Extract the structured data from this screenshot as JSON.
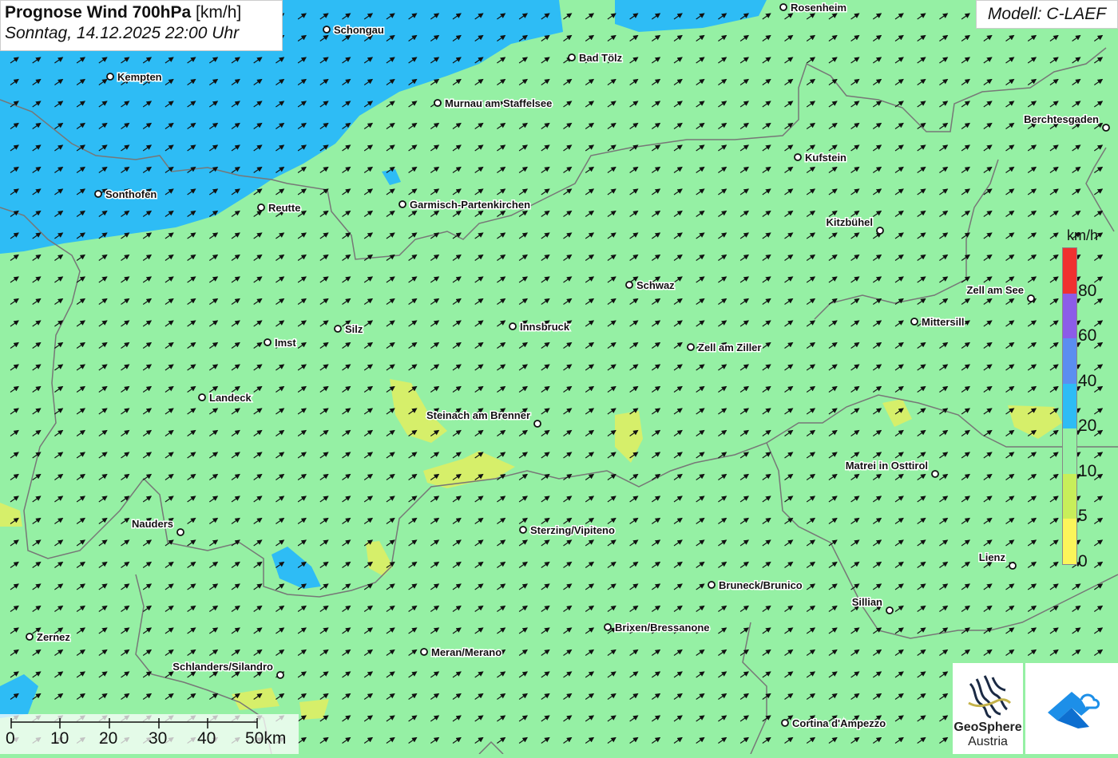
{
  "title": {
    "main": "Prognose Wind 700hPa",
    "unit": "[km/h]",
    "datetime": "Sonntag, 14.12.2025 22:00 Uhr"
  },
  "model": "Modell: C-LAEF",
  "legend": {
    "unit": "km/h",
    "labels": [
      "80",
      "60",
      "40",
      "20",
      "10",
      "5",
      "0"
    ],
    "colors": [
      "#f03030",
      "#8c5ce8",
      "#5b8ef0",
      "#2ebcf5",
      "#95f0a4",
      "#c8ee5a",
      "#fbf55a"
    ]
  },
  "scalebar": {
    "labels": [
      "0",
      "10",
      "20",
      "30",
      "40",
      "50km"
    ]
  },
  "logos": {
    "geosphere_line1": "GeoSphere",
    "geosphere_line2": "Austria"
  },
  "colors": {
    "calm_green": "#95f0a4",
    "blue_20": "#2ebcf5",
    "yellow_5": "#d6ef6a"
  },
  "cities": [
    {
      "name": "Rosenheim"
    },
    {
      "name": "Schongau"
    },
    {
      "name": "Bad Tölz"
    },
    {
      "name": "Kempten"
    },
    {
      "name": "Murnau am Staffelsee"
    },
    {
      "name": "Berchtesgaden"
    },
    {
      "name": "Kufstein"
    },
    {
      "name": "Sonthofen"
    },
    {
      "name": "Reutte"
    },
    {
      "name": "Garmisch-Partenkirchen"
    },
    {
      "name": "Kitzbühel"
    },
    {
      "name": "Schwaz"
    },
    {
      "name": "Zell am See"
    },
    {
      "name": "Innsbruck"
    },
    {
      "name": "Silz"
    },
    {
      "name": "Mittersill"
    },
    {
      "name": "Imst"
    },
    {
      "name": "Zell am Ziller"
    },
    {
      "name": "Landeck"
    },
    {
      "name": "Steinach am Brenner"
    },
    {
      "name": "Matrei in Osttirol"
    },
    {
      "name": "Nauders"
    },
    {
      "name": "Sterzing/Vipiteno"
    },
    {
      "name": "Lienz"
    },
    {
      "name": "Bruneck/Brunico"
    },
    {
      "name": "Sillian"
    },
    {
      "name": "Brixen/Bressanone"
    },
    {
      "name": "Zernez"
    },
    {
      "name": "Meran/Merano"
    },
    {
      "name": "Schlanders/Silandro"
    },
    {
      "name": "Cortina d'Ampezzo"
    }
  ]
}
